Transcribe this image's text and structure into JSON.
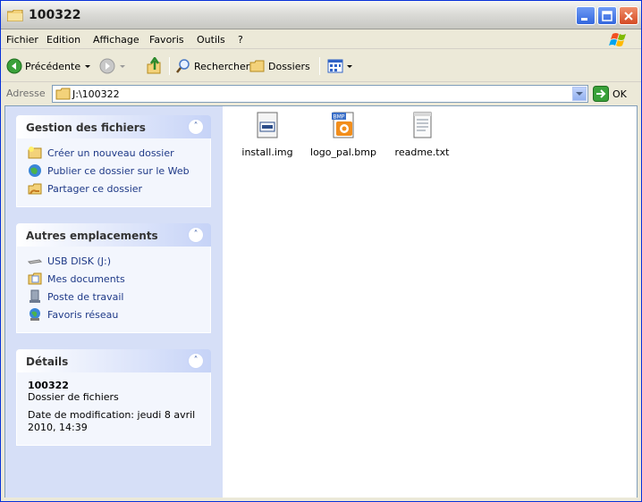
{
  "window": {
    "title": "100322"
  },
  "menu": {
    "items": [
      {
        "label": "Fichier"
      },
      {
        "label": "Edition"
      },
      {
        "label": "Affichage"
      },
      {
        "label": "Favoris"
      },
      {
        "label": "Outils"
      },
      {
        "label": "?"
      }
    ]
  },
  "toolbar": {
    "back_label": "Précédente",
    "search_label": "Rechercher",
    "folders_label": "Dossiers"
  },
  "address": {
    "label": "Adresse",
    "value": "J:\\100322",
    "go_label": "OK"
  },
  "tasks": {
    "file_tasks_title": "Gestion des fichiers",
    "file_tasks": [
      {
        "label": "Créer un nouveau dossier",
        "icon": "new-folder-icon"
      },
      {
        "label": "Publier ce dossier sur le Web",
        "icon": "publish-web-icon"
      },
      {
        "label": "Partager ce dossier",
        "icon": "share-folder-icon"
      }
    ],
    "places_title": "Autres emplacements",
    "places": [
      {
        "label": "USB DISK (J:)",
        "icon": "usb-drive-icon"
      },
      {
        "label": "Mes documents",
        "icon": "my-documents-icon"
      },
      {
        "label": "Poste de travail",
        "icon": "my-computer-icon"
      },
      {
        "label": "Favoris réseau",
        "icon": "network-places-icon"
      }
    ],
    "details_title": "Détails",
    "details": {
      "name": "100322",
      "type": "Dossier de fichiers",
      "modified_line1": "Date de modification: jeudi 8 avril",
      "modified_line2": "2010, 14:39"
    }
  },
  "files": [
    {
      "name": "install.img",
      "icon": "disk-image-icon"
    },
    {
      "name": "logo_pal.bmp",
      "icon": "bmp-image-icon"
    },
    {
      "name": "readme.txt",
      "icon": "text-file-icon"
    }
  ],
  "colors": {
    "task_link": "#215dc6",
    "task_pane": "#d6dff7",
    "panel_body": "#f3f6fd"
  }
}
